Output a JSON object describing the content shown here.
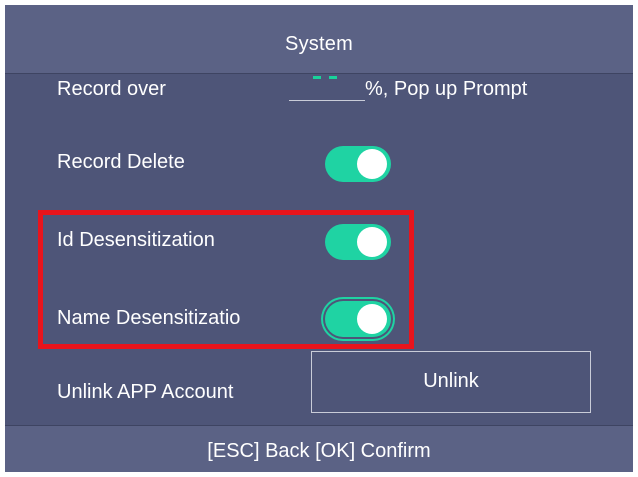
{
  "header": {
    "title": "System"
  },
  "settings": {
    "record_over": {
      "label": "Record over",
      "value": "",
      "suffix": "%, Pop up Prompt"
    },
    "record_delete": {
      "label": "Record Delete",
      "enabled": true
    },
    "id_desensitization": {
      "label": "Id Desensitization",
      "enabled": true
    },
    "name_desensitization": {
      "label": "Name Desensitizatio",
      "enabled": true,
      "focused": true
    },
    "unlink_app_account": {
      "label": "Unlink APP Account",
      "button_label": "Unlink"
    }
  },
  "footer": {
    "hint": "[ESC] Back [OK] Confirm"
  },
  "colors": {
    "background": "#4e5578",
    "bar": "#5b6285",
    "toggle_on": "#1fd3a3",
    "highlight": "#e8141c"
  }
}
